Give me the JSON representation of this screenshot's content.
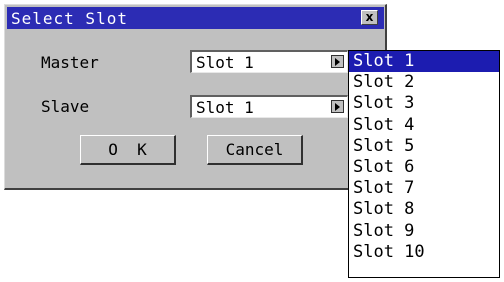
{
  "dialog": {
    "title": "Select Slot",
    "close_glyph": "x"
  },
  "master": {
    "label": "Master",
    "value": "Slot 1",
    "arrow_icon": "triangle-right"
  },
  "slave": {
    "label": "Slave",
    "value": "Slot 1",
    "arrow_icon": "triangle-right"
  },
  "buttons": {
    "ok_label": "O  K",
    "cancel_label": "Cancel"
  },
  "dropdown": {
    "selected_index": 0,
    "options": [
      "Slot 1",
      "Slot 2",
      "Slot 3",
      "Slot 4",
      "Slot 5",
      "Slot 6",
      "Slot 7",
      "Slot 8",
      "Slot 9",
      "Slot 10"
    ]
  },
  "colors": {
    "titlebar": "#2c2cb4",
    "selection": "#1c1cb0",
    "dialog_face": "#c0c0c0"
  }
}
